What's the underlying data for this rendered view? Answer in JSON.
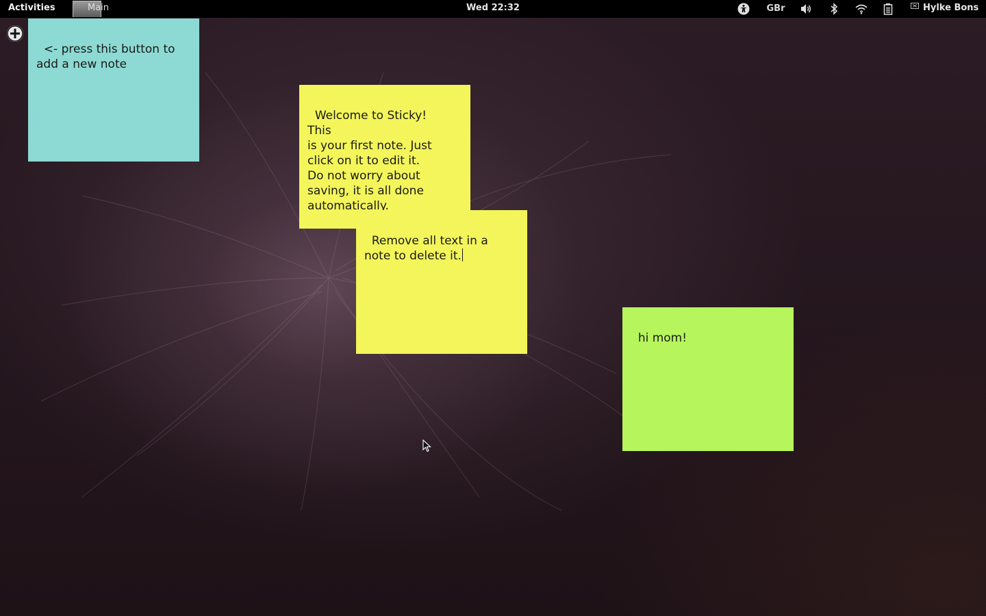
{
  "topbar": {
    "activities_label": "Activities",
    "app_name": "Main",
    "clock": "Wed 22:32",
    "keyboard_layout": "GBr",
    "user_name": "Hylke Bons",
    "icons": [
      "accessibility-icon",
      "volume-icon",
      "bluetooth-icon",
      "wifi-icon",
      "battery-icon",
      "user-status-icon"
    ]
  },
  "add_button": {
    "icon": "add-circle-icon"
  },
  "notes": [
    {
      "color": "#8cdad3",
      "text": "<- press this button to\nadd a new note"
    },
    {
      "color": "#f3f55a",
      "text": "Welcome to Sticky!\nThis\nis your first note. Just\nclick on it to edit it.\nDo not worry about\nsaving, it is all done\nautomatically."
    },
    {
      "color": "#f3f55a",
      "text": "Remove all text in a\nnote to delete it."
    },
    {
      "color": "#b6f55c",
      "text": "hi mom!"
    }
  ],
  "colors": {
    "topbar": "#000000",
    "desktop_background": "#24161d"
  }
}
